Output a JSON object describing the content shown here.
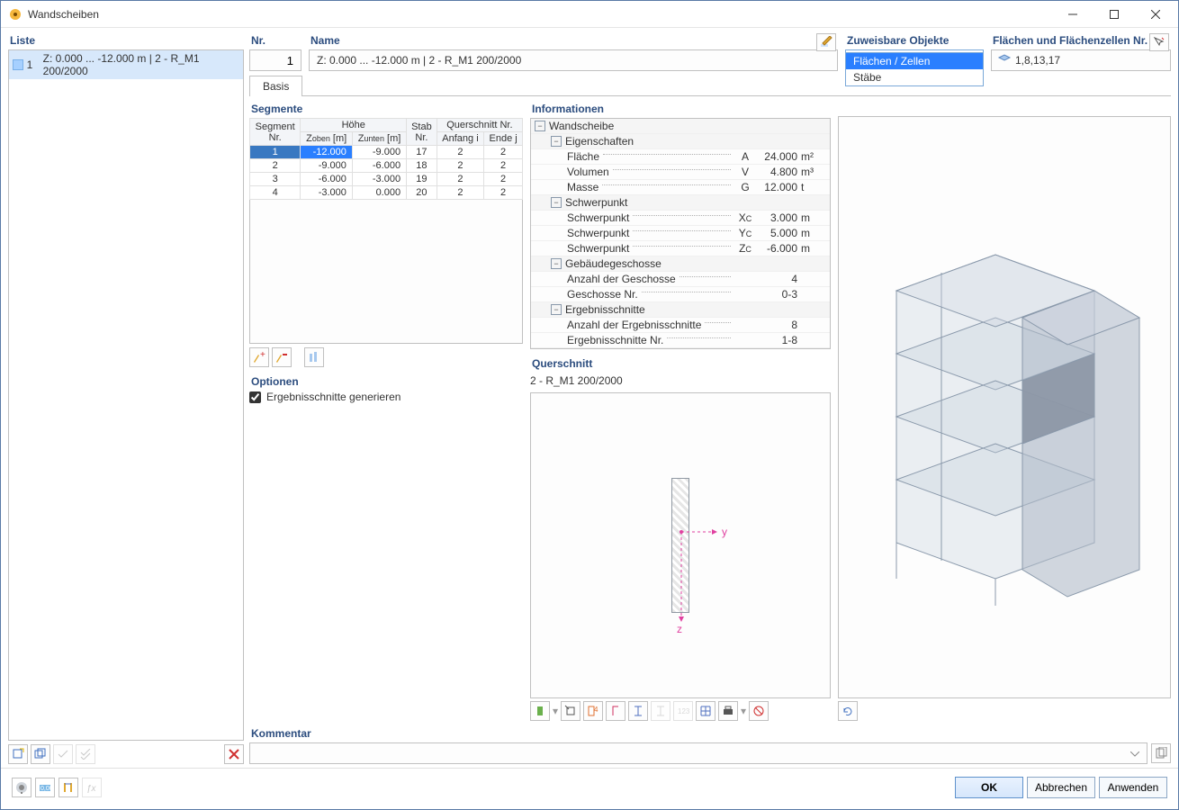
{
  "window": {
    "title": "Wandscheiben"
  },
  "liste": {
    "title": "Liste",
    "items": [
      {
        "nr": "1",
        "text": "Z: 0.000 ... -12.000 m | 2 - R_M1 200/2000",
        "selected": true
      }
    ]
  },
  "nr": {
    "title": "Nr.",
    "value": "1"
  },
  "name": {
    "title": "Name",
    "value": "Z: 0.000 ... -12.000  m | 2 - R_M1 200/2000"
  },
  "assignable": {
    "title": "Zuweisbare Objekte",
    "selected": "Flächen / Zellen",
    "options": [
      "Flächen / Zellen",
      "Stäbe"
    ]
  },
  "ids": {
    "title": "Flächen und Flächenzellen Nr.",
    "value": "1,8,13,17"
  },
  "tabs": {
    "basis": "Basis"
  },
  "segmente": {
    "title": "Segmente",
    "headers": {
      "seg": "Segment\nNr.",
      "hoehe": "Höhe",
      "zoben": "Zoben [m]",
      "zunten": "Zunten [m]",
      "stab": "Stab\nNr.",
      "quer": "Querschnitt Nr.",
      "anfang": "Anfang i",
      "ende": "Ende j"
    },
    "rows": [
      {
        "nr": "1",
        "zo": "-12.000",
        "zu": "-9.000",
        "stab": "17",
        "ai": "2",
        "ej": "2",
        "sel": true,
        "selcol": "zo"
      },
      {
        "nr": "2",
        "zo": "-9.000",
        "zu": "-6.000",
        "stab": "18",
        "ai": "2",
        "ej": "2"
      },
      {
        "nr": "3",
        "zo": "-6.000",
        "zu": "-3.000",
        "stab": "19",
        "ai": "2",
        "ej": "2"
      },
      {
        "nr": "4",
        "zo": "-3.000",
        "zu": "0.000",
        "stab": "20",
        "ai": "2",
        "ej": "2"
      }
    ]
  },
  "optionen": {
    "title": "Optionen",
    "ergebnis": "Ergebnisschnitte generieren"
  },
  "info": {
    "title": "Informationen",
    "wandscheibe": "Wandscheibe",
    "eigenschaften": "Eigenschaften",
    "flaeche": {
      "lbl": "Fläche",
      "sym": "A",
      "val": "24.000",
      "unit": "m²"
    },
    "volumen": {
      "lbl": "Volumen",
      "sym": "V",
      "val": "4.800",
      "unit": "m³"
    },
    "masse": {
      "lbl": "Masse",
      "sym": "G",
      "val": "12.000",
      "unit": "t"
    },
    "schwerpunkt": "Schwerpunkt",
    "sp_x": {
      "lbl": "Schwerpunkt",
      "sym": "Xc",
      "val": "3.000",
      "unit": "m"
    },
    "sp_y": {
      "lbl": "Schwerpunkt",
      "sym": "Yc",
      "val": "5.000",
      "unit": "m"
    },
    "sp_z": {
      "lbl": "Schwerpunkt",
      "sym": "Zc",
      "val": "-6.000",
      "unit": "m"
    },
    "geschosse": "Gebäudegeschosse",
    "anz_g": {
      "lbl": "Anzahl der Geschosse",
      "val": "4"
    },
    "g_nr": {
      "lbl": "Geschosse Nr.",
      "val": "0-3"
    },
    "ergschn": "Ergebnisschnitte",
    "anz_e": {
      "lbl": "Anzahl der Ergebnisschnitte",
      "val": "8"
    },
    "e_nr": {
      "lbl": "Ergebnisschnitte Nr.",
      "val": "1-8"
    }
  },
  "querschnitt": {
    "title": "Querschnitt",
    "text": "2 - R_M1 200/2000",
    "y": "y",
    "z": "z"
  },
  "kommentar": {
    "title": "Kommentar",
    "value": ""
  },
  "footer": {
    "ok": "OK",
    "cancel": "Abbrechen",
    "apply": "Anwenden"
  }
}
